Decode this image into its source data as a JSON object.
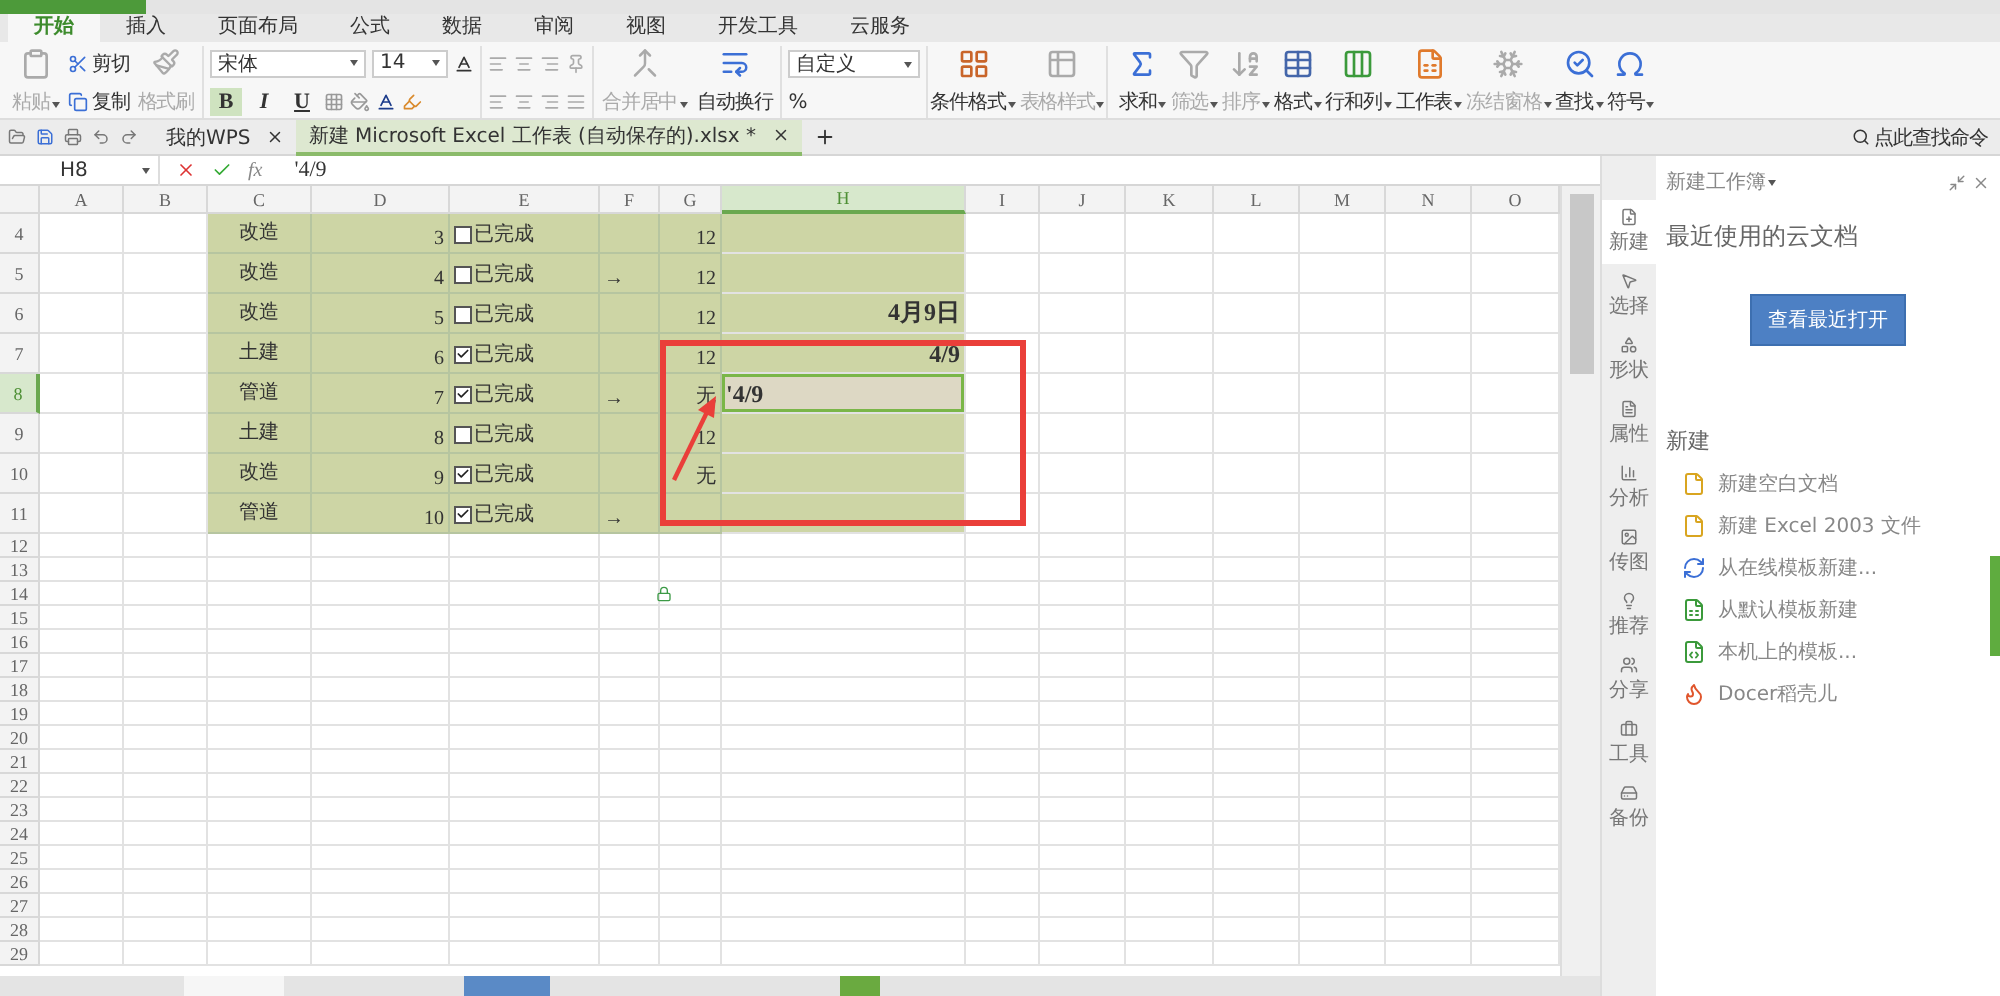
{
  "app_tabs": [
    {
      "label": "开始",
      "selected": true
    },
    {
      "label": "插入",
      "selected": false
    },
    {
      "label": "页面布局",
      "selected": false
    },
    {
      "label": "公式",
      "selected": false
    },
    {
      "label": "数据",
      "selected": false
    },
    {
      "label": "审阅",
      "selected": false
    },
    {
      "label": "视图",
      "selected": false
    },
    {
      "label": "开发工具",
      "selected": false
    },
    {
      "label": "云服务",
      "selected": false
    }
  ],
  "ribbon": {
    "paste": {
      "label": "粘贴",
      "disabled": true
    },
    "cut": "剪切",
    "copy": "复制",
    "format_painter": {
      "label": "格式刷",
      "disabled": true
    },
    "font_name": "宋体",
    "font_size": "14",
    "styles": [
      {
        "label": "B",
        "active": true
      },
      {
        "label": "I",
        "active": false
      },
      {
        "label": "U",
        "active": false
      }
    ],
    "merge": {
      "label": "合并居中",
      "disabled": true
    },
    "wrap": {
      "label": "自动换行",
      "disabled": false
    },
    "number_format": "自定义",
    "percent": "%",
    "tools": [
      {
        "kind": "conditional",
        "label": "条件格式",
        "disabled": false
      },
      {
        "kind": "table-style",
        "label": "表格样式",
        "disabled": true
      },
      {
        "kind": "sum",
        "label": "求和",
        "disabled": false
      },
      {
        "kind": "filter",
        "label": "筛选",
        "disabled": true
      },
      {
        "kind": "sort",
        "label": "排序",
        "disabled": true
      },
      {
        "kind": "format",
        "label": "格式",
        "disabled": false
      },
      {
        "kind": "rowcol",
        "label": "行和列",
        "disabled": false
      },
      {
        "kind": "sheet",
        "label": "工作表",
        "disabled": false
      },
      {
        "kind": "freeze",
        "label": "冻结窗格",
        "disabled": true
      },
      {
        "kind": "find",
        "label": "查找",
        "disabled": false
      },
      {
        "kind": "symbol",
        "label": "符号",
        "disabled": false
      }
    ]
  },
  "doc_tabs": [
    {
      "label": "我的WPS",
      "selected": false
    },
    {
      "label": "新建 Microsoft Excel 工作表 (自动保存的).xlsx *",
      "selected": true
    }
  ],
  "command_search": "点此查找命令",
  "formula_bar": {
    "cell": "H8",
    "fx": "fx",
    "formula": "'4/9"
  },
  "columns": [
    {
      "label": "A",
      "selected": false
    },
    {
      "label": "B",
      "selected": false
    },
    {
      "label": "C",
      "selected": false
    },
    {
      "label": "D",
      "selected": false
    },
    {
      "label": "E",
      "selected": false
    },
    {
      "label": "F",
      "selected": false
    },
    {
      "label": "G",
      "selected": false
    },
    {
      "label": "H",
      "selected": true
    },
    {
      "label": "I",
      "selected": false
    },
    {
      "label": "J",
      "selected": false
    },
    {
      "label": "K",
      "selected": false
    },
    {
      "label": "L",
      "selected": false
    },
    {
      "label": "M",
      "selected": false
    },
    {
      "label": "N",
      "selected": false
    },
    {
      "label": "O",
      "selected": false
    }
  ],
  "rows": [
    {
      "number": "4",
      "selected": false,
      "category": "改造",
      "index": "3",
      "done": false,
      "done_label": "已完成",
      "g": "12"
    },
    {
      "number": "5",
      "selected": false,
      "category": "改造",
      "index": "4",
      "done": false,
      "done_label": "已完成",
      "arrow": "→",
      "g": "12"
    },
    {
      "number": "6",
      "selected": false,
      "category": "改造",
      "index": "5",
      "done": false,
      "done_label": "已完成",
      "g": "12",
      "h": {
        "value": "4月9日",
        "kind": "date"
      }
    },
    {
      "number": "7",
      "selected": false,
      "category": "土建",
      "index": "6",
      "done": true,
      "done_label": "已完成",
      "g": "12",
      "h": {
        "value": "4/9",
        "kind": "date"
      }
    },
    {
      "number": "8",
      "selected": true,
      "category": "管道",
      "index": "7",
      "done": true,
      "done_label": "已完成",
      "arrow": "→",
      "g": "无",
      "h": {
        "value": "'4/9",
        "kind": "text"
      }
    },
    {
      "number": "9",
      "selected": false,
      "category": "土建",
      "index": "8",
      "done": false,
      "done_label": "已完成",
      "g": "12"
    },
    {
      "number": "10",
      "selected": false,
      "category": "改造",
      "index": "9",
      "done": true,
      "done_label": "已完成",
      "g": "无"
    },
    {
      "number": "11",
      "selected": false,
      "category": "管道",
      "index": "10",
      "done": true,
      "done_label": "已完成",
      "arrow": "→"
    }
  ],
  "empty_rows": [
    "12",
    "13",
    "14",
    "15",
    "16",
    "17",
    "18",
    "19",
    "20",
    "21",
    "22",
    "23",
    "24",
    "25",
    "26",
    "27",
    "28",
    "29"
  ],
  "task_pane": {
    "title": "新建工作簿",
    "side_tabs": [
      {
        "label": "新建",
        "selected": true
      },
      {
        "label": "选择",
        "selected": false
      },
      {
        "label": "形状",
        "selected": false
      },
      {
        "label": "属性",
        "selected": false
      },
      {
        "label": "分析",
        "selected": false
      },
      {
        "label": "传图",
        "selected": false
      },
      {
        "label": "推荐",
        "selected": false
      },
      {
        "label": "分享",
        "selected": false
      },
      {
        "label": "工具",
        "selected": false
      },
      {
        "label": "备份",
        "selected": false
      }
    ],
    "recent_heading": "最近使用的云文档",
    "recent_button": "查看最近打开",
    "new_heading": "新建",
    "new_items": [
      {
        "kind": "blank",
        "label": "新建空白文档"
      },
      {
        "kind": "blank",
        "label": "新建 Excel 2003 文件"
      },
      {
        "kind": "online",
        "label": "从在线模板新建..."
      },
      {
        "kind": "default",
        "label": "从默认模板新建"
      },
      {
        "kind": "local",
        "label": "本机上的模板..."
      },
      {
        "kind": "docer",
        "label": "Docer稻壳儿"
      }
    ]
  }
}
